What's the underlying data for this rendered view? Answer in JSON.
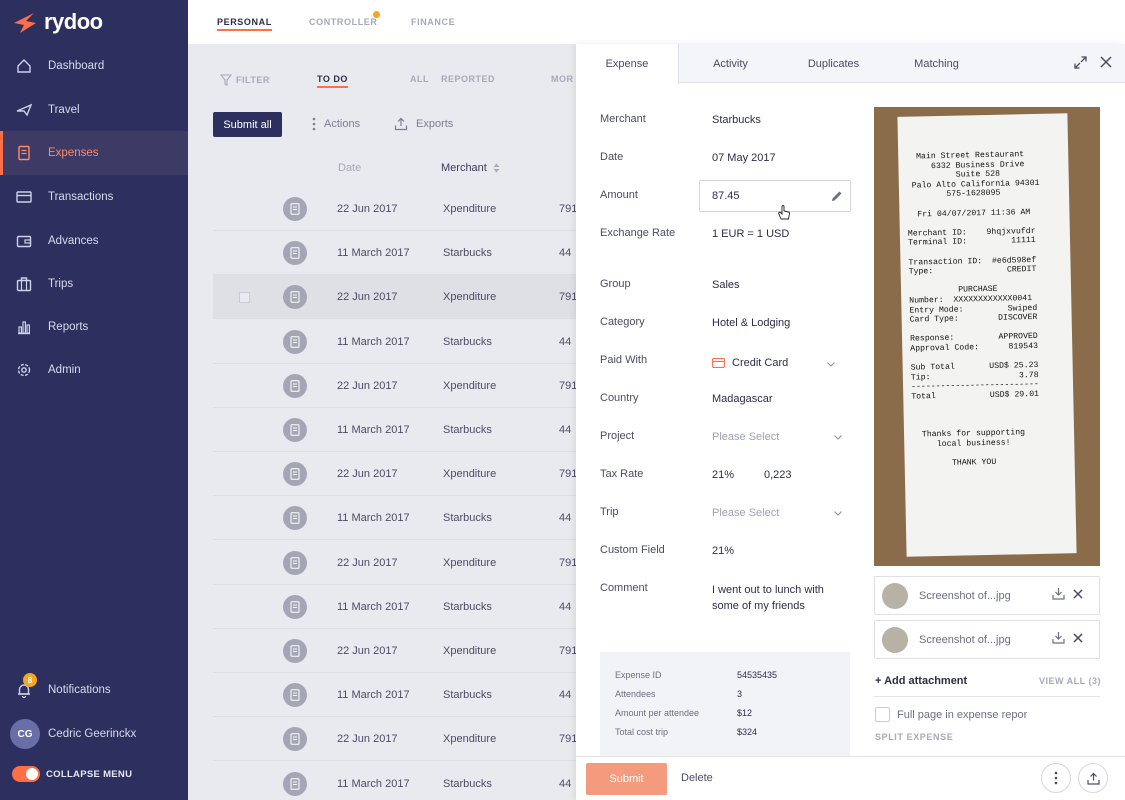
{
  "app": {
    "brand": "rydoo"
  },
  "sidebar": {
    "items": [
      {
        "label": "Dashboard",
        "icon": "home-icon"
      },
      {
        "label": "Travel",
        "icon": "travel-icon"
      },
      {
        "label": "Expenses",
        "icon": "expenses-icon",
        "active": true
      },
      {
        "label": "Transactions",
        "icon": "card-icon"
      },
      {
        "label": "Advances",
        "icon": "wallet-icon"
      },
      {
        "label": "Trips",
        "icon": "suitcase-icon"
      },
      {
        "label": "Reports",
        "icon": "bar-chart-icon"
      },
      {
        "label": "Admin",
        "icon": "gear-icon"
      }
    ],
    "notifications": {
      "label": "Notifications",
      "count": "8"
    },
    "user": {
      "initials": "CG",
      "name": "Cedric Geerinckx"
    },
    "collapse_label": "COLLAPSE MENU"
  },
  "top_tabs": [
    "PERSONAL",
    "CONTROLLER",
    "FINANCE"
  ],
  "list": {
    "filter_label": "FILTER",
    "filter_tabs": [
      "TO DO",
      "ALL",
      "REPORTED",
      "MOR"
    ],
    "submit_all": "Submit all",
    "actions_label": "Actions",
    "exports_label": "Exports",
    "headers": {
      "date": "Date",
      "merchant": "Merchant"
    },
    "rows": [
      {
        "date": "22 Jun 2017",
        "merchant": "Xpenditure",
        "amount": "791"
      },
      {
        "date": "11 March 2017",
        "merchant": "Starbucks",
        "amount": "44"
      },
      {
        "date": "22 Jun 2017",
        "merchant": "Xpenditure",
        "amount": "791"
      },
      {
        "date": "11 March 2017",
        "merchant": "Starbucks",
        "amount": "44"
      },
      {
        "date": "22 Jun 2017",
        "merchant": "Xpenditure",
        "amount": "791"
      },
      {
        "date": "11 March 2017",
        "merchant": "Starbucks",
        "amount": "44"
      },
      {
        "date": "22 Jun 2017",
        "merchant": "Xpenditure",
        "amount": "791"
      },
      {
        "date": "11 March 2017",
        "merchant": "Starbucks",
        "amount": "44"
      },
      {
        "date": "22 Jun 2017",
        "merchant": "Xpenditure",
        "amount": "791"
      },
      {
        "date": "11 March 2017",
        "merchant": "Starbucks",
        "amount": "44"
      },
      {
        "date": "22 Jun 2017",
        "merchant": "Xpenditure",
        "amount": "791"
      },
      {
        "date": "11 March 2017",
        "merchant": "Starbucks",
        "amount": "44"
      },
      {
        "date": "22 Jun 2017",
        "merchant": "Xpenditure",
        "amount": "791"
      },
      {
        "date": "11 March 2017",
        "merchant": "Starbucks",
        "amount": "44"
      }
    ]
  },
  "panel": {
    "tabs": [
      "Expense",
      "Activity",
      "Duplicates",
      "Matching"
    ],
    "fields": {
      "merchant": {
        "label": "Merchant",
        "value": "Starbucks"
      },
      "date": {
        "label": "Date",
        "value": "07 May 2017"
      },
      "amount": {
        "label": "Amount",
        "value": "87.45"
      },
      "exchange_rate": {
        "label": "Exchange Rate",
        "value": "1 EUR = 1 USD"
      },
      "group": {
        "label": "Group",
        "value": "Sales"
      },
      "category": {
        "label": "Category",
        "value": "Hotel & Lodging"
      },
      "paid_with": {
        "label": "Paid With",
        "value": "Credit Card"
      },
      "country": {
        "label": "Country",
        "value": "Madagascar"
      },
      "project": {
        "label": "Project",
        "placeholder": "Please Select"
      },
      "tax_rate": {
        "label": "Tax Rate",
        "value": "21%",
        "amount": "0,223"
      },
      "trip": {
        "label": "Trip",
        "placeholder": "Please Select"
      },
      "custom_field": {
        "label": "Custom Field",
        "value": "21%"
      },
      "comment": {
        "label": "Comment",
        "value": "I went out to lunch with some of my friends"
      }
    },
    "info": [
      {
        "label": "Expense ID",
        "value": "54535435"
      },
      {
        "label": "Attendees",
        "value": "3"
      },
      {
        "label": "Amount per attendee",
        "value": "$12"
      },
      {
        "label": "Total cost trip",
        "value": "$324"
      }
    ],
    "receipt_text": "  Main Street Restaurant\n     6332 Business Drive\n          Suite 528\n Palo Alto California 94301\n        575-1628095\n\n  Fri 04/07/2017 11:36 AM\n\nMerchant ID:    9hqjxvufdr\nTerminal ID:         11111\n\nTransaction ID:  #e6d598ef\nType:               CREDIT\n\n          PURCHASE\nNumber:  XXXXXXXXXXXX0041\nEntry Mode:         Swiped\nCard Type:        DISCOVER\n\nResponse:         APPROVED\nApproval Code:      819543\n\nSub Total       USD$ 25.23\nTip:                  3.78\n--------------------------\nTotal           USD$ 29.01\n\n\n\n  Thanks for supporting\n     local business!\n\n        THANK YOU",
    "attachments": [
      "Screenshot of...jpg",
      "Screenshot of...jpg"
    ],
    "add_attachment": "+ Add attachment",
    "view_all": "VIEW ALL (3)",
    "full_page_label": "Full page in expense report",
    "split_expense": "SPLIT EXPENSE",
    "submit": "Submit",
    "delete": "Delete"
  },
  "colors": {
    "sidebar": "#2d2f5e",
    "accent": "#ff6f47",
    "submit": "#f39b7c"
  }
}
